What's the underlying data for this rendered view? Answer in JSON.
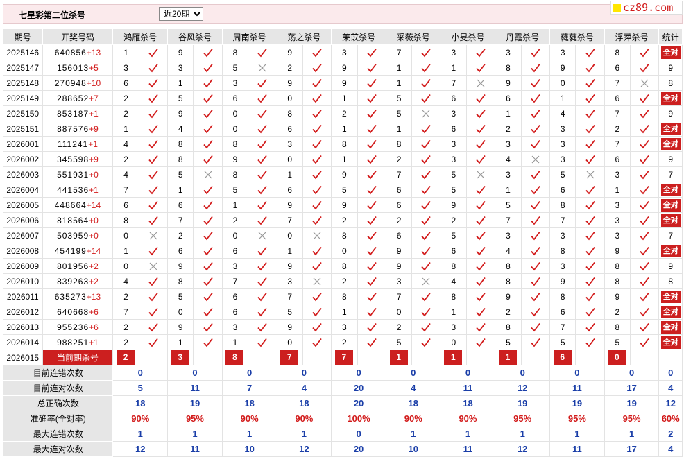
{
  "header": {
    "title": "七星彩第二位杀号",
    "period_selected": "近20期",
    "period_options": [
      "近20期"
    ]
  },
  "logo": {
    "text": "cz89.com"
  },
  "columns": {
    "issue": "期号",
    "nums": "开奖号码",
    "stat": "统计",
    "experts": [
      "鸿雁杀号",
      "谷风杀号",
      "周南杀号",
      "荡之杀号",
      "苿苡杀号",
      "采薇杀号",
      "小旻杀号",
      "丹霞杀号",
      "蕤蕤杀号",
      "浮萍杀号"
    ]
  },
  "rows": [
    {
      "issue": "2025146",
      "nums": "640856",
      "plus": "+13",
      "kills": [
        "1",
        "9",
        "8",
        "9",
        "3",
        "7",
        "3",
        "3",
        "3",
        "8"
      ],
      "ok": [
        1,
        1,
        1,
        1,
        1,
        1,
        1,
        1,
        1,
        1
      ],
      "stat": "全对"
    },
    {
      "issue": "2025147",
      "nums": "156013",
      "plus": "+5",
      "kills": [
        "3",
        "3",
        "5",
        "2",
        "9",
        "1",
        "1",
        "8",
        "9",
        "6"
      ],
      "ok": [
        1,
        1,
        0,
        1,
        1,
        1,
        1,
        1,
        1,
        1
      ],
      "stat": "9"
    },
    {
      "issue": "2025148",
      "nums": "270948",
      "plus": "+10",
      "kills": [
        "6",
        "1",
        "3",
        "9",
        "9",
        "1",
        "7",
        "9",
        "0",
        "7"
      ],
      "ok": [
        1,
        1,
        1,
        1,
        1,
        1,
        0,
        1,
        1,
        0
      ],
      "stat": "8"
    },
    {
      "issue": "2025149",
      "nums": "288652",
      "plus": "+7",
      "kills": [
        "2",
        "5",
        "6",
        "0",
        "1",
        "5",
        "6",
        "6",
        "1",
        "6"
      ],
      "ok": [
        1,
        1,
        1,
        1,
        1,
        1,
        1,
        1,
        1,
        1
      ],
      "stat": "全对"
    },
    {
      "issue": "2025150",
      "nums": "853187",
      "plus": "+1",
      "kills": [
        "2",
        "9",
        "0",
        "8",
        "2",
        "5",
        "3",
        "1",
        "4",
        "7"
      ],
      "ok": [
        1,
        1,
        1,
        1,
        1,
        0,
        1,
        1,
        1,
        1
      ],
      "stat": "9"
    },
    {
      "issue": "2025151",
      "nums": "887576",
      "plus": "+9",
      "kills": [
        "1",
        "4",
        "0",
        "6",
        "1",
        "1",
        "6",
        "2",
        "3",
        "2"
      ],
      "ok": [
        1,
        1,
        1,
        1,
        1,
        1,
        1,
        1,
        1,
        1
      ],
      "stat": "全对"
    },
    {
      "issue": "2026001",
      "nums": "111241",
      "plus": "+1",
      "kills": [
        "4",
        "8",
        "8",
        "3",
        "8",
        "8",
        "3",
        "3",
        "3",
        "7"
      ],
      "ok": [
        1,
        1,
        1,
        1,
        1,
        1,
        1,
        1,
        1,
        1
      ],
      "stat": "全对"
    },
    {
      "issue": "2026002",
      "nums": "345598",
      "plus": "+9",
      "kills": [
        "2",
        "8",
        "9",
        "0",
        "1",
        "2",
        "3",
        "4",
        "3",
        "6"
      ],
      "ok": [
        1,
        1,
        1,
        1,
        1,
        1,
        1,
        0,
        1,
        1
      ],
      "stat": "9"
    },
    {
      "issue": "2026003",
      "nums": "551931",
      "plus": "+0",
      "kills": [
        "4",
        "5",
        "8",
        "1",
        "9",
        "7",
        "5",
        "3",
        "5",
        "3"
      ],
      "ok": [
        1,
        0,
        1,
        1,
        1,
        1,
        0,
        1,
        0,
        1
      ],
      "stat": "7"
    },
    {
      "issue": "2026004",
      "nums": "441536",
      "plus": "+1",
      "kills": [
        "7",
        "1",
        "5",
        "6",
        "5",
        "6",
        "5",
        "1",
        "6",
        "1"
      ],
      "ok": [
        1,
        1,
        1,
        1,
        1,
        1,
        1,
        1,
        1,
        1
      ],
      "stat": "全对"
    },
    {
      "issue": "2026005",
      "nums": "448664",
      "plus": "+14",
      "kills": [
        "6",
        "6",
        "1",
        "9",
        "9",
        "6",
        "9",
        "5",
        "8",
        "3"
      ],
      "ok": [
        1,
        1,
        1,
        1,
        1,
        1,
        1,
        1,
        1,
        1
      ],
      "stat": "全对"
    },
    {
      "issue": "2026006",
      "nums": "818564",
      "plus": "+0",
      "kills": [
        "8",
        "7",
        "2",
        "7",
        "2",
        "2",
        "2",
        "7",
        "7",
        "3"
      ],
      "ok": [
        1,
        1,
        1,
        1,
        1,
        1,
        1,
        1,
        1,
        1
      ],
      "stat": "全对"
    },
    {
      "issue": "2026007",
      "nums": "503959",
      "plus": "+0",
      "kills": [
        "0",
        "2",
        "0",
        "0",
        "8",
        "6",
        "5",
        "3",
        "3",
        "3"
      ],
      "ok": [
        0,
        1,
        0,
        0,
        1,
        1,
        1,
        1,
        1,
        1
      ],
      "stat": "7"
    },
    {
      "issue": "2026008",
      "nums": "454199",
      "plus": "+14",
      "kills": [
        "1",
        "6",
        "6",
        "1",
        "0",
        "9",
        "6",
        "4",
        "8",
        "9"
      ],
      "ok": [
        1,
        1,
        1,
        1,
        1,
        1,
        1,
        1,
        1,
        1
      ],
      "stat": "全对"
    },
    {
      "issue": "2026009",
      "nums": "801956",
      "plus": "+2",
      "kills": [
        "0",
        "9",
        "3",
        "9",
        "8",
        "9",
        "8",
        "8",
        "3",
        "8"
      ],
      "ok": [
        0,
        1,
        1,
        1,
        1,
        1,
        1,
        1,
        1,
        1
      ],
      "stat": "9"
    },
    {
      "issue": "2026010",
      "nums": "839263",
      "plus": "+2",
      "kills": [
        "4",
        "8",
        "7",
        "3",
        "2",
        "3",
        "4",
        "8",
        "9",
        "8"
      ],
      "ok": [
        1,
        1,
        1,
        0,
        1,
        0,
        1,
        1,
        1,
        1
      ],
      "stat": "8"
    },
    {
      "issue": "2026011",
      "nums": "635273",
      "plus": "+13",
      "kills": [
        "2",
        "5",
        "6",
        "7",
        "8",
        "7",
        "8",
        "9",
        "8",
        "9"
      ],
      "ok": [
        1,
        1,
        1,
        1,
        1,
        1,
        1,
        1,
        1,
        1
      ],
      "stat": "全对"
    },
    {
      "issue": "2026012",
      "nums": "640668",
      "plus": "+6",
      "kills": [
        "7",
        "0",
        "6",
        "5",
        "1",
        "0",
        "1",
        "2",
        "6",
        "2"
      ],
      "ok": [
        1,
        1,
        1,
        1,
        1,
        1,
        1,
        1,
        1,
        1
      ],
      "stat": "全对"
    },
    {
      "issue": "2026013",
      "nums": "955236",
      "plus": "+6",
      "kills": [
        "2",
        "9",
        "3",
        "9",
        "3",
        "2",
        "3",
        "8",
        "7",
        "8"
      ],
      "ok": [
        1,
        1,
        1,
        1,
        1,
        1,
        1,
        1,
        1,
        1
      ],
      "stat": "全对"
    },
    {
      "issue": "2026014",
      "nums": "988251",
      "plus": "+1",
      "kills": [
        "2",
        "1",
        "1",
        "0",
        "2",
        "5",
        "0",
        "5",
        "5",
        "5"
      ],
      "ok": [
        1,
        1,
        1,
        1,
        1,
        1,
        1,
        1,
        1,
        1
      ],
      "stat": "全对"
    }
  ],
  "current": {
    "issue": "2026015",
    "label": "当前期杀号",
    "kills": [
      "2",
      "3",
      "8",
      "7",
      "7",
      "1",
      "1",
      "1",
      "6",
      "0"
    ]
  },
  "stats": [
    {
      "label": "目前连错次数",
      "values": [
        "0",
        "0",
        "0",
        "0",
        "0",
        "0",
        "0",
        "0",
        "0",
        "0",
        "0"
      ],
      "red": false
    },
    {
      "label": "目前连对次数",
      "values": [
        "5",
        "11",
        "7",
        "4",
        "20",
        "4",
        "11",
        "12",
        "11",
        "17",
        "4"
      ],
      "red": false
    },
    {
      "label": "总正确次数",
      "values": [
        "18",
        "19",
        "18",
        "18",
        "20",
        "18",
        "18",
        "19",
        "19",
        "19",
        "12"
      ],
      "red": false
    },
    {
      "label": "准确率(全对率)",
      "values": [
        "90%",
        "95%",
        "90%",
        "90%",
        "100%",
        "90%",
        "90%",
        "95%",
        "95%",
        "95%",
        "60%"
      ],
      "red": true
    },
    {
      "label": "最大连错次数",
      "values": [
        "1",
        "1",
        "1",
        "1",
        "0",
        "1",
        "1",
        "1",
        "1",
        "1",
        "2"
      ],
      "red": false
    },
    {
      "label": "最大连对次数",
      "values": [
        "12",
        "11",
        "10",
        "12",
        "20",
        "10",
        "11",
        "12",
        "11",
        "17",
        "4"
      ],
      "red": false
    }
  ]
}
